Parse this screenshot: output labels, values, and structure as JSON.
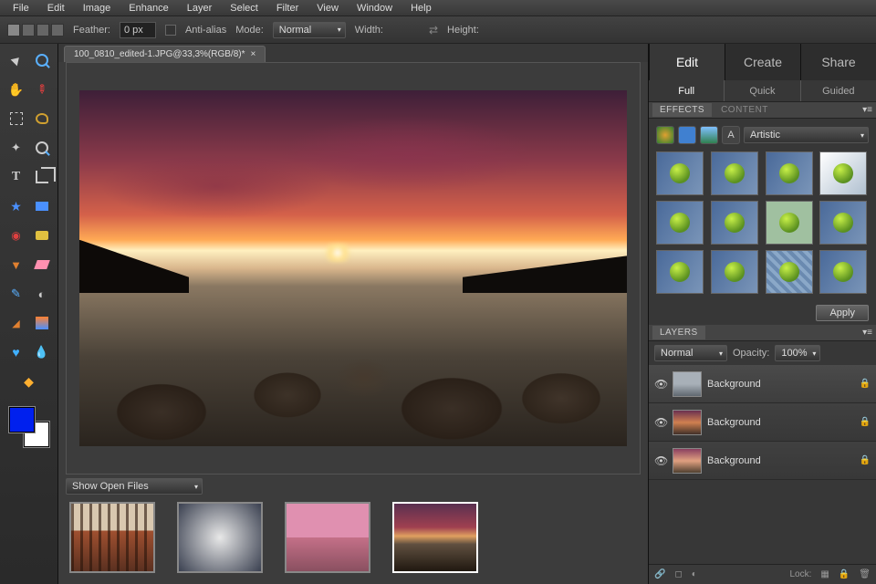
{
  "menubar": [
    "File",
    "Edit",
    "Image",
    "Enhance",
    "Layer",
    "Select",
    "Filter",
    "View",
    "Window",
    "Help"
  ],
  "options": {
    "feather_label": "Feather:",
    "feather_value": "0 px",
    "antialias_label": "Anti-alias",
    "mode_label": "Mode:",
    "mode_value": "Normal",
    "width_label": "Width:",
    "height_label": "Height:"
  },
  "document": {
    "tab_title": "100_0810_edited-1.JPG@33,3%(RGB/8)*"
  },
  "open_files": {
    "label": "Show Open Files"
  },
  "mode_tabs": {
    "edit": "Edit",
    "create": "Create",
    "share": "Share"
  },
  "sub_tabs": {
    "full": "Full",
    "quick": "Quick",
    "guided": "Guided"
  },
  "effects_panel": {
    "tab1": "EFFECTS",
    "tab2": "CONTENT",
    "filter_select": "Artistic",
    "apply": "Apply"
  },
  "layers_panel": {
    "title": "LAYERS",
    "blend_mode": "Normal",
    "opacity_label": "Opacity:",
    "opacity_value": "100%",
    "lock_label": "Lock:",
    "layers": [
      {
        "name": "Background"
      },
      {
        "name": "Background"
      },
      {
        "name": "Background"
      }
    ]
  }
}
